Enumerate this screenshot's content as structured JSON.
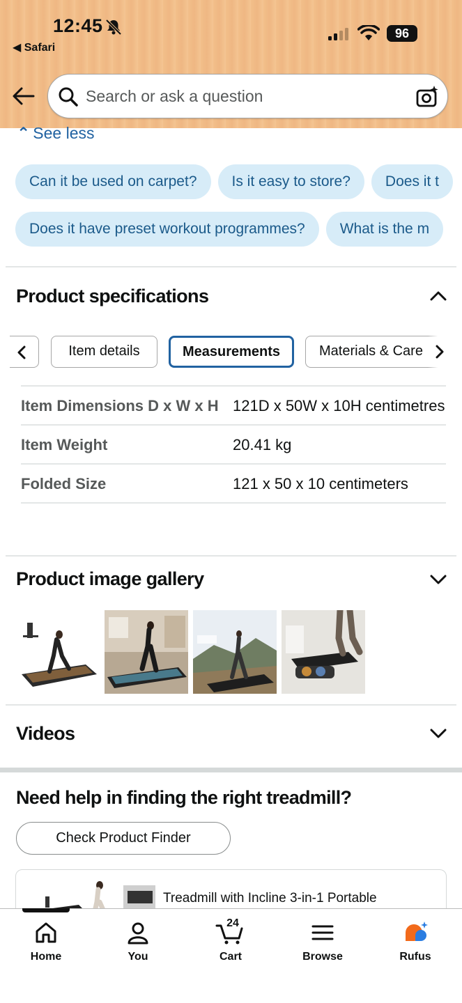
{
  "status_bar": {
    "time": "12:45",
    "back_app": "◀ Safari",
    "battery": "96"
  },
  "search": {
    "placeholder": "Search or ask a question"
  },
  "see_less": "See less",
  "question_chips": {
    "row1": [
      "Can it be used on carpet?",
      "Is it easy to store?",
      "Does it t"
    ],
    "row2": [
      "Does it have preset workout programmes?",
      "What is the m"
    ]
  },
  "specifications": {
    "title": "Product specifications",
    "tabs": [
      "Item details",
      "Measurements",
      "Materials & Care"
    ],
    "active_tab": "Measurements",
    "rows": [
      {
        "key": "Item Dimensions D x W x H",
        "value": "121D x 50W x 10H centimetres"
      },
      {
        "key": "Item Weight",
        "value": "20.41 kg"
      },
      {
        "key": "Folded Size",
        "value": "121 x 50 x 10 centimeters"
      }
    ]
  },
  "gallery": {
    "title": "Product image gallery"
  },
  "videos": {
    "title": "Videos"
  },
  "help": {
    "title": "Need help in finding the right treadmill?",
    "button": "Check Product Finder",
    "product_title": "Treadmill with Incline 3-in-1 Portable"
  },
  "bottom_nav": {
    "home": "Home",
    "you": "You",
    "cart": "Cart",
    "cart_count": "24",
    "browse": "Browse",
    "rufus": "Rufus"
  },
  "colors": {
    "header_bg": "#f2bf8a",
    "chip_bg": "#d7ecf8",
    "link": "#2162a1",
    "active_tab_border": "#2162a1"
  }
}
